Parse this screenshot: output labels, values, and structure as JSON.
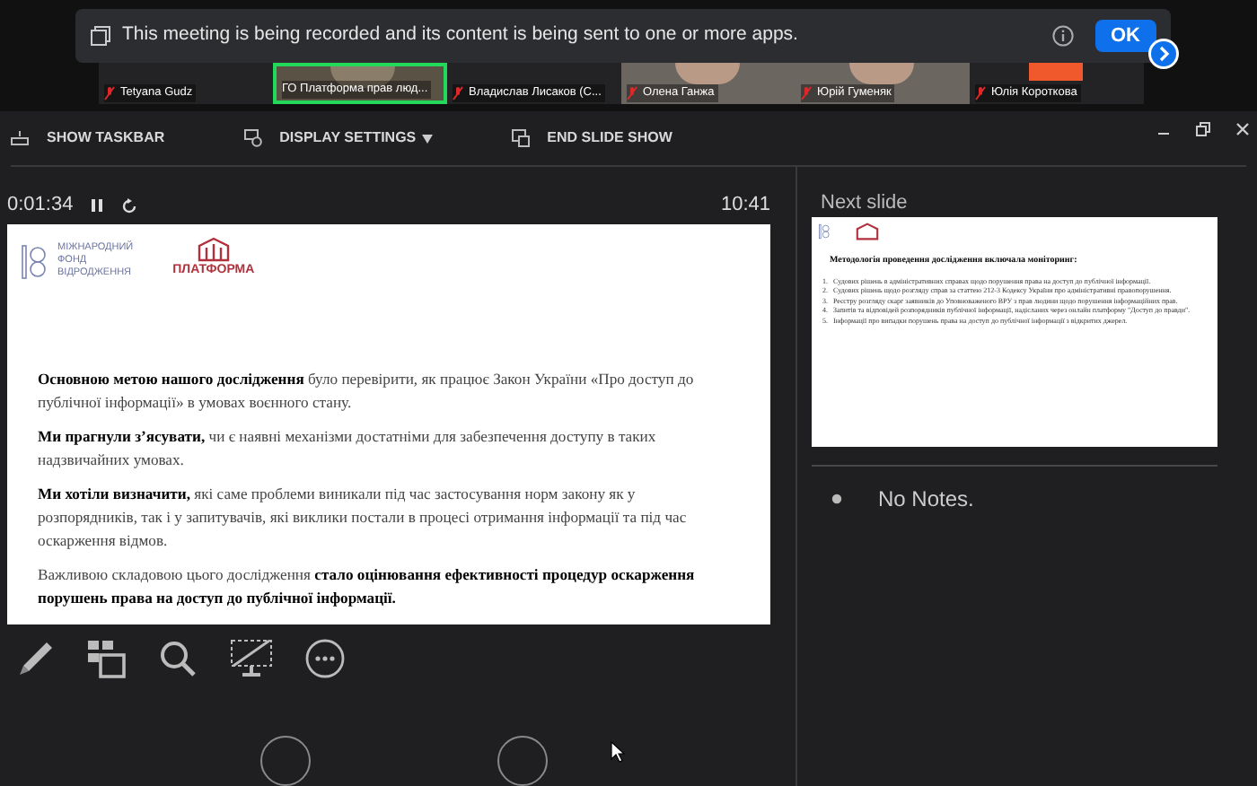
{
  "notification": {
    "text": "This meeting is being recorded and its content is being sent to one or more apps.",
    "button": "OK"
  },
  "participants": [
    {
      "name": "Tetyana Gudz",
      "kind": "dark",
      "selected": false
    },
    {
      "name": "ГО Платформа прав люд...",
      "kind": "room",
      "selected": true
    },
    {
      "name": "Владислав Лисаков (С...",
      "kind": "dark",
      "selected": false
    },
    {
      "name": "Олена Ганжа",
      "kind": "video",
      "selected": false
    },
    {
      "name": "Юрій Гуменяк",
      "kind": "video",
      "selected": false
    },
    {
      "name": "Юлія Короткова",
      "kind": "avatar",
      "selected": false
    }
  ],
  "toolbar": [
    {
      "label": "SHOW TASKBAR",
      "kind": "taskbar"
    },
    {
      "label": "DISPLAY SETTINGS",
      "kind": "display"
    },
    {
      "label": "END SLIDE SHOW",
      "kind": "end"
    }
  ],
  "elapsed": "0:01:34",
  "clock": "10:41",
  "slide": {
    "logo_left": [
      "МІЖНАРОДНИЙ",
      "ФОНД",
      "ВІДРОДЖЕННЯ"
    ],
    "logo_right": "ПЛАТФОРМА",
    "paragraphs": [
      "**Основною метою нашого дослідження** було перевірити, як працює Закон України «Про доступ до публічної інформації» в умовах воєнного стану.",
      "**Ми прагнули з’ясувати,** чи є наявні механізми достатніми для забезпечення доступу в таких надзвичайних умовах.",
      "**Ми хотіли визначити,** які саме проблеми виникали під час застосування норм закону як у розпорядників, так і у запитувачів, які виклики постали в процесі отримання інформації та під час оскарження відмов.",
      "Важливою складовою цього дослідження **стало оцінювання ефективності процедур оскарження порушень права на доступ до публічної інформації.**"
    ]
  },
  "next_slide": {
    "label": "Next slide",
    "title": "Методологія проведення дослідження включала моніторинг:",
    "items": [
      {
        "number": "1.",
        "text": "Судових рішень в адміністративних справах щодо порушення права на доступ до публічної інформації."
      },
      {
        "number": "2.",
        "text": "Судових рішень щодо розгляду справ за статтею 212-3 Кодексу України про адміністративні правопорушення."
      },
      {
        "number": "3.",
        "text": "Реєстру розгляду скарг заявників до Уповноваженого ВРУ з прав людини щодо порушення інформаційних прав."
      },
      {
        "number": "4.",
        "text": "Запитів та відповідей розпорядників публічної інформації, надісланих через онлайн платформу \"Доступ до правди\"."
      },
      {
        "number": "5.",
        "text": "Інформації про випадки порушень права на доступ до публічної інформації з відкритих джерел."
      }
    ]
  },
  "notes": "No Notes."
}
